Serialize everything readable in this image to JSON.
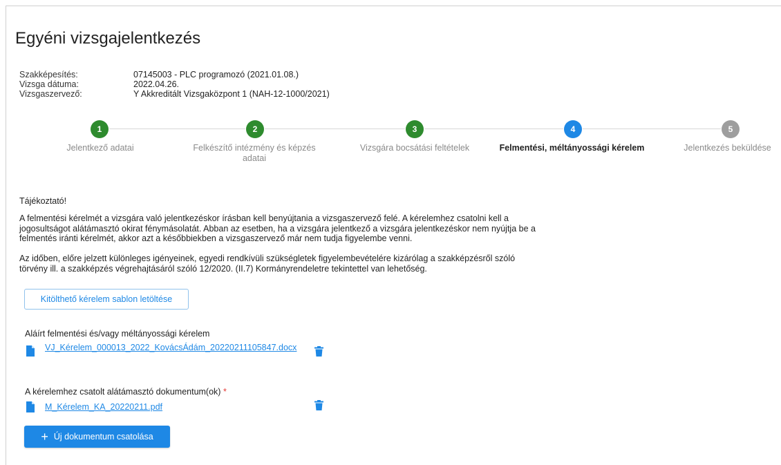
{
  "page": {
    "title": "Egyéni vizsgajelentkezés"
  },
  "info": [
    {
      "key": "Szakképesítés:",
      "value": "07145003 - PLC programozó (2021.01.08.)"
    },
    {
      "key": "Vizsga dátuma:",
      "value": "2022.04.26."
    },
    {
      "key": "Vizsgaszervező:",
      "value": "Y Akkreditált Vizsgaközpont 1 (NAH-12-1000/2021)"
    }
  ],
  "steps": [
    {
      "number": "1",
      "label": "Jelentkező adatai",
      "state": "done"
    },
    {
      "number": "2",
      "label": "Felkészítő intézmény és képzés adatai",
      "state": "done"
    },
    {
      "number": "3",
      "label": "Vizsgára bocsátási feltételek",
      "state": "done"
    },
    {
      "number": "4",
      "label": "Felmentési, méltányossági kérelem",
      "state": "active"
    },
    {
      "number": "5",
      "label": "Jelentkezés beküldése",
      "state": "todo"
    }
  ],
  "notice": {
    "heading": "Tájékoztató!",
    "paragraph1": "A felmentési kérelmét a vizsgára való jelentkezéskor írásban kell benyújtania a vizsgaszervező felé. A kérelemhez csatolni kell a jogosultságot alátámasztó okirat fénymásolatát. Abban az esetben, ha a vizsgára jelentkező a vizsgára jelentkezéskor nem nyújtja be a felmentés iránti kérelmét, akkor azt a későbbiekben a vizsgaszervező már nem tudja figyelembe venni.",
    "paragraph2": "Az időben, előre jelzett különleges igényeinek, egyedi rendkívüli szükségletek figyelembevételére kizárólag a szakképzésről szóló törvény ill. a szakképzés végrehajtásáról szóló 12/2020. (II.7) Kormányrendeletre tekintettel van lehetőség."
  },
  "download_button": "Kitölthető kérelem sablon letöltése",
  "signed_request": {
    "label": "Aláírt felmentési és/vagy méltányossági kérelem",
    "file": "VJ_Kérelem_000013_2022_KovácsÁdám_20220211105847.docx"
  },
  "supporting_docs": {
    "label": "A kérelemhez csatolt alátámasztó dokumentum(ok)",
    "required_mark": "*",
    "file": "M_Kérelem_KA_20220211.pdf"
  },
  "add_button": {
    "icon": "plus-icon",
    "label": "Új dokumentum csatolása"
  },
  "colors": {
    "primary": "#1e88e5",
    "done": "#2e8b2e",
    "todo": "#9e9e9e",
    "required": "#e53935"
  }
}
